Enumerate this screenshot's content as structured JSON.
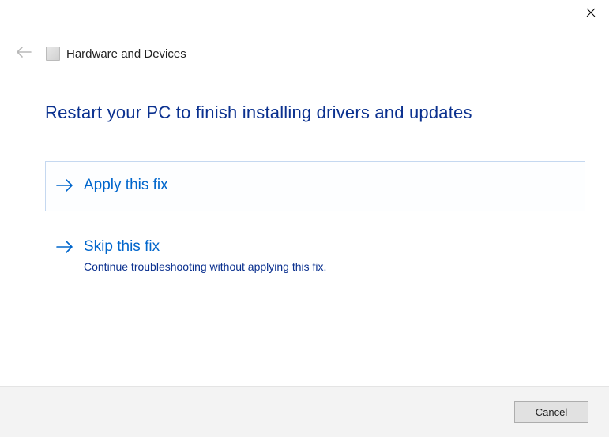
{
  "header": {
    "title": "Hardware and Devices"
  },
  "main": {
    "heading": "Restart your PC to finish installing drivers and updates",
    "options": [
      {
        "title": "Apply this fix",
        "desc": null
      },
      {
        "title": "Skip this fix",
        "desc": "Continue troubleshooting without applying this fix."
      }
    ]
  },
  "footer": {
    "cancel_label": "Cancel"
  }
}
